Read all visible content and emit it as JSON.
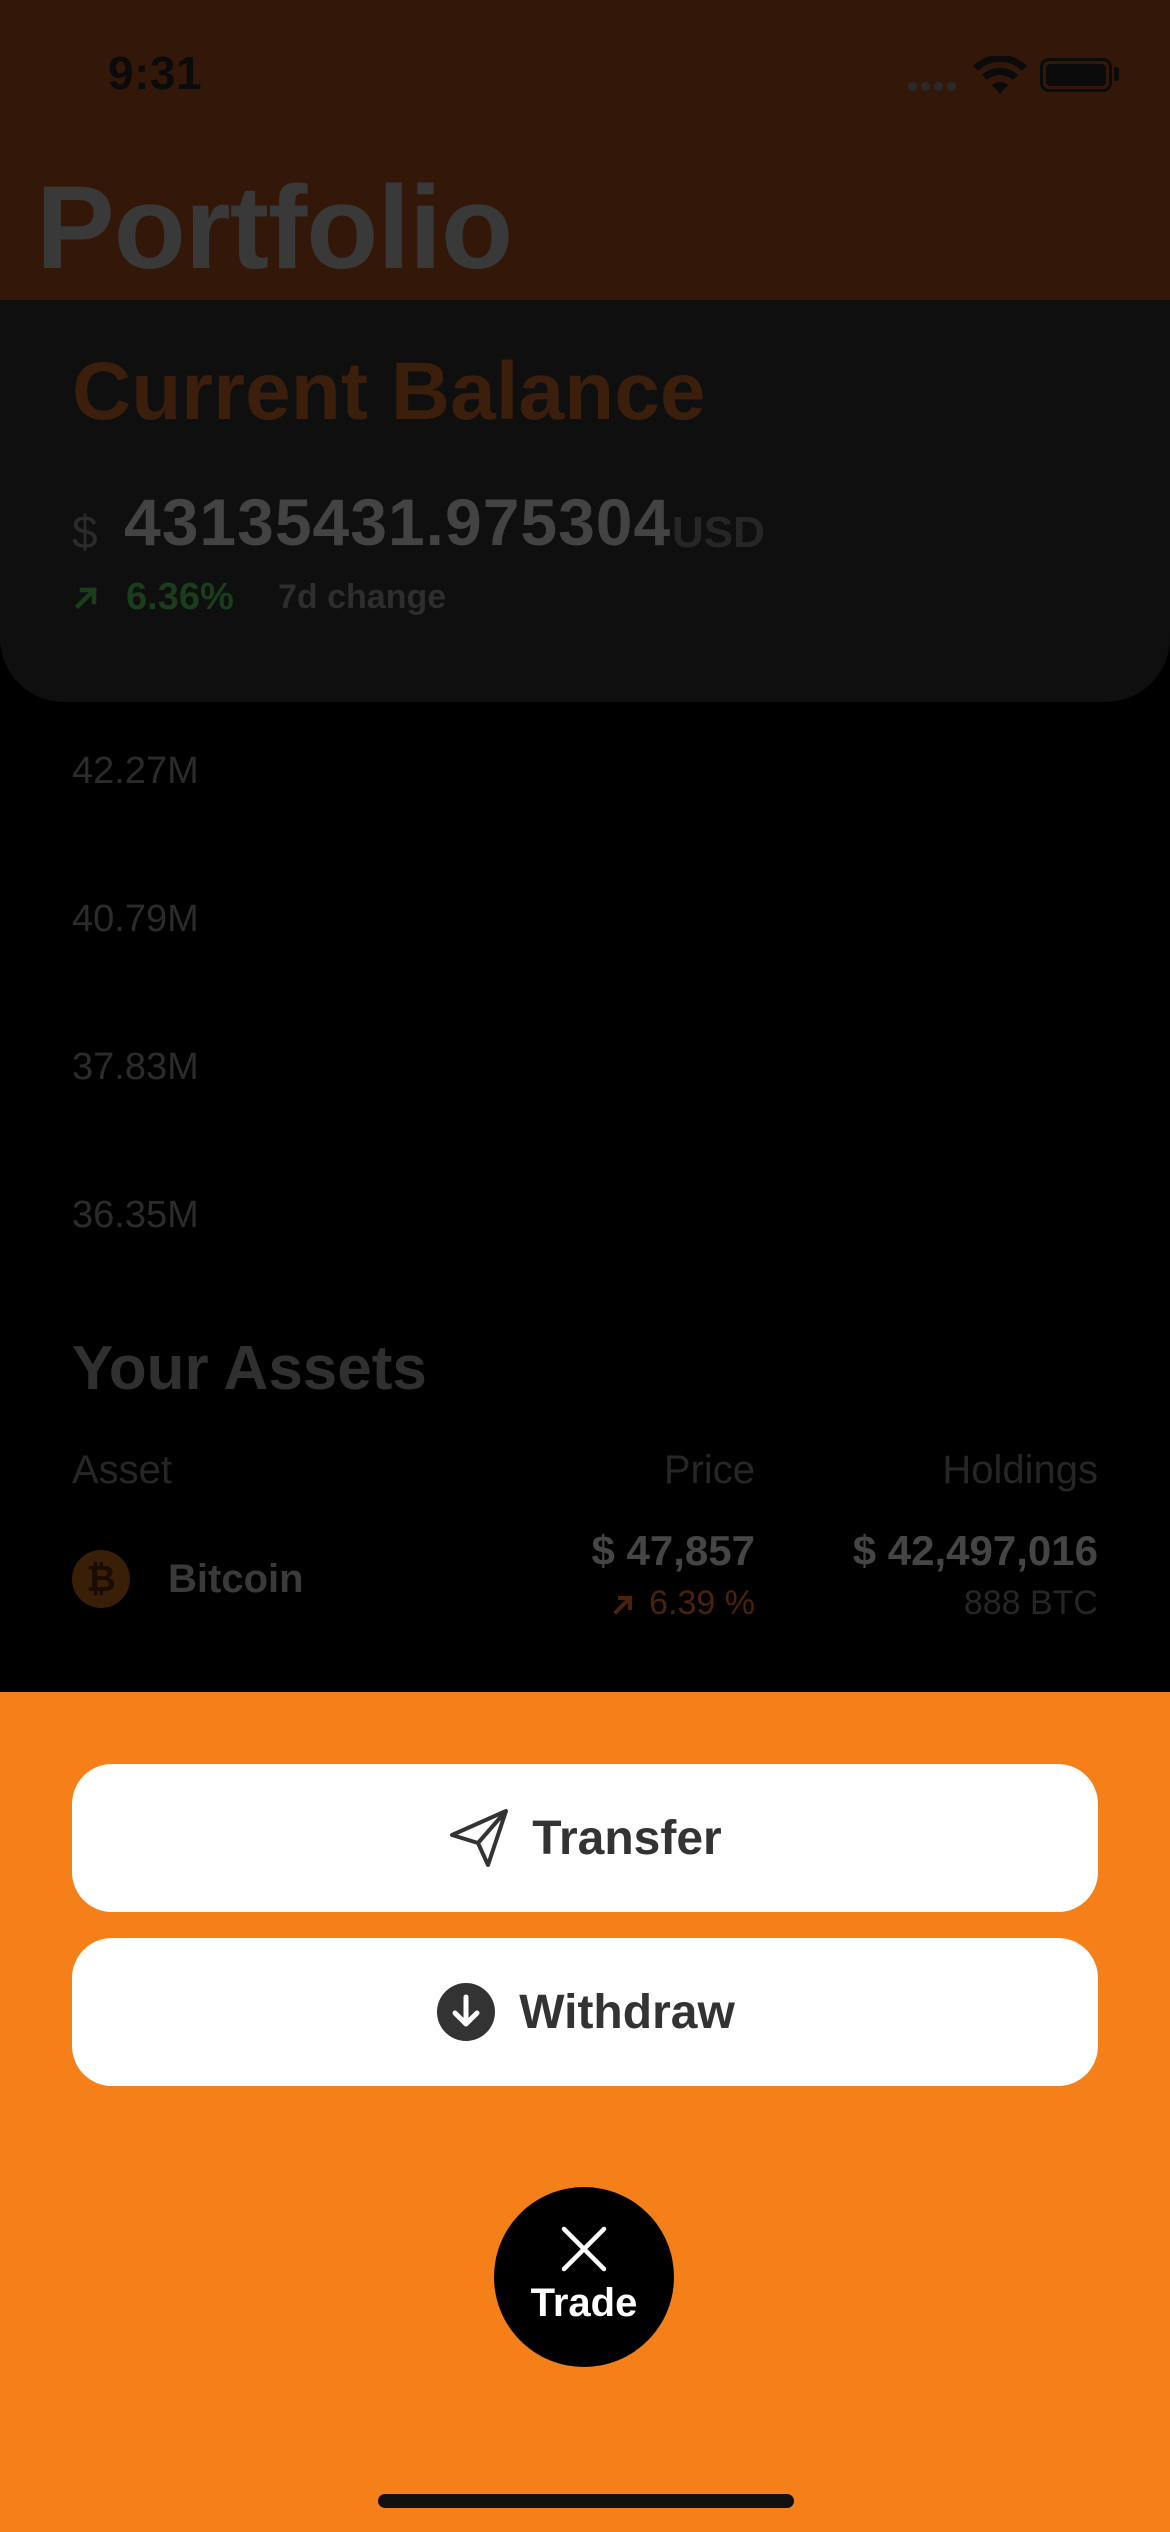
{
  "status_bar": {
    "time": "9:31"
  },
  "header": {
    "title": "Portfolio"
  },
  "balance": {
    "title": "Current Balance",
    "currency_symbol": "$",
    "amount": "43135431.975304",
    "unit": "USD",
    "change_pct": "6.36%",
    "change_label": "7d change"
  },
  "chart": {
    "y_ticks": [
      "42.27M",
      "40.79M",
      "37.83M",
      "36.35M"
    ]
  },
  "assets": {
    "title": "Your Assets",
    "columns": {
      "asset": "Asset",
      "price": "Price",
      "holdings": "Holdings"
    },
    "rows": [
      {
        "icon": "bitcoin-icon",
        "icon_glyph": "₿",
        "name": "Bitcoin",
        "price": "$ 47,857",
        "price_change": "6.39 %",
        "holdings_value": "$ 42,497,016",
        "holdings_qty": "888 BTC"
      }
    ]
  },
  "actions": {
    "transfer_label": "Transfer",
    "withdraw_label": "Withdraw",
    "trade_label": "Trade"
  },
  "colors": {
    "accent": "#f58019",
    "sheet_background": "#f58019",
    "button_background": "#ffffff",
    "button_text": "#333333",
    "fab_background": "#000000"
  }
}
